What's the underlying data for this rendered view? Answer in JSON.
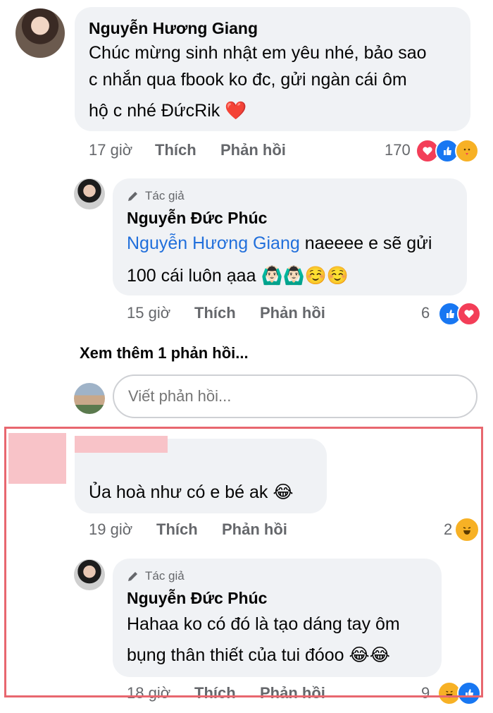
{
  "comments": [
    {
      "author": "Nguyễn Hương Giang",
      "text_lines": [
        "Chúc mừng sinh nhật em yêu nhé, bảo sao",
        "c nhắn qua fbook ko đc, gửi ngàn cái ôm",
        "hộ c nhé ĐứcRik"
      ],
      "emoji": "❤️",
      "time": "17 giờ",
      "like": "Thích",
      "reply": "Phản hồi",
      "reaction_count": "170",
      "reactions": [
        "heart-icon",
        "like-icon",
        "care-icon"
      ]
    },
    {
      "author_tag": "Tác giả",
      "author": "Nguyễn Đức Phúc",
      "mention": "Nguyễn Hương Giang",
      "text_rest": " naeeee e sẽ gửi",
      "text_line2": "100 cái luôn ạaa",
      "emojis": [
        "🙆🏻‍♂️",
        "🙆🏻‍♂️",
        "☺️",
        "☺️"
      ],
      "time": "15 giờ",
      "like": "Thích",
      "reply": "Phản hồi",
      "reaction_count": "6",
      "reactions": [
        "like-icon",
        "heart-icon"
      ]
    }
  ],
  "see_more": "Xem thêm 1 phản hồi...",
  "reply_input": {
    "placeholder": "Viết phản hồi..."
  },
  "highlight_color": "#e8676f",
  "redacted_color": "#f8c3c8",
  "highlighted": {
    "comment": {
      "text": "Ủa hoà như có e bé ak",
      "emoji": "😂",
      "time": "19 giờ",
      "like": "Thích",
      "reply": "Phản hồi",
      "reaction_count": "2",
      "reactions": [
        "haha-icon"
      ]
    },
    "reply": {
      "author_tag": "Tác giả",
      "author": "Nguyễn Đức Phúc",
      "text_lines": [
        "Hahaa ko có đó là tạo dáng tay ôm",
        "bụng thân thiết của tui đóoo"
      ],
      "emojis": [
        "😂",
        "😂"
      ],
      "time": "18 giờ",
      "like": "Thích",
      "reply": "Phản hồi",
      "reaction_count": "9",
      "reactions": [
        "haha-icon",
        "like-icon"
      ]
    }
  }
}
